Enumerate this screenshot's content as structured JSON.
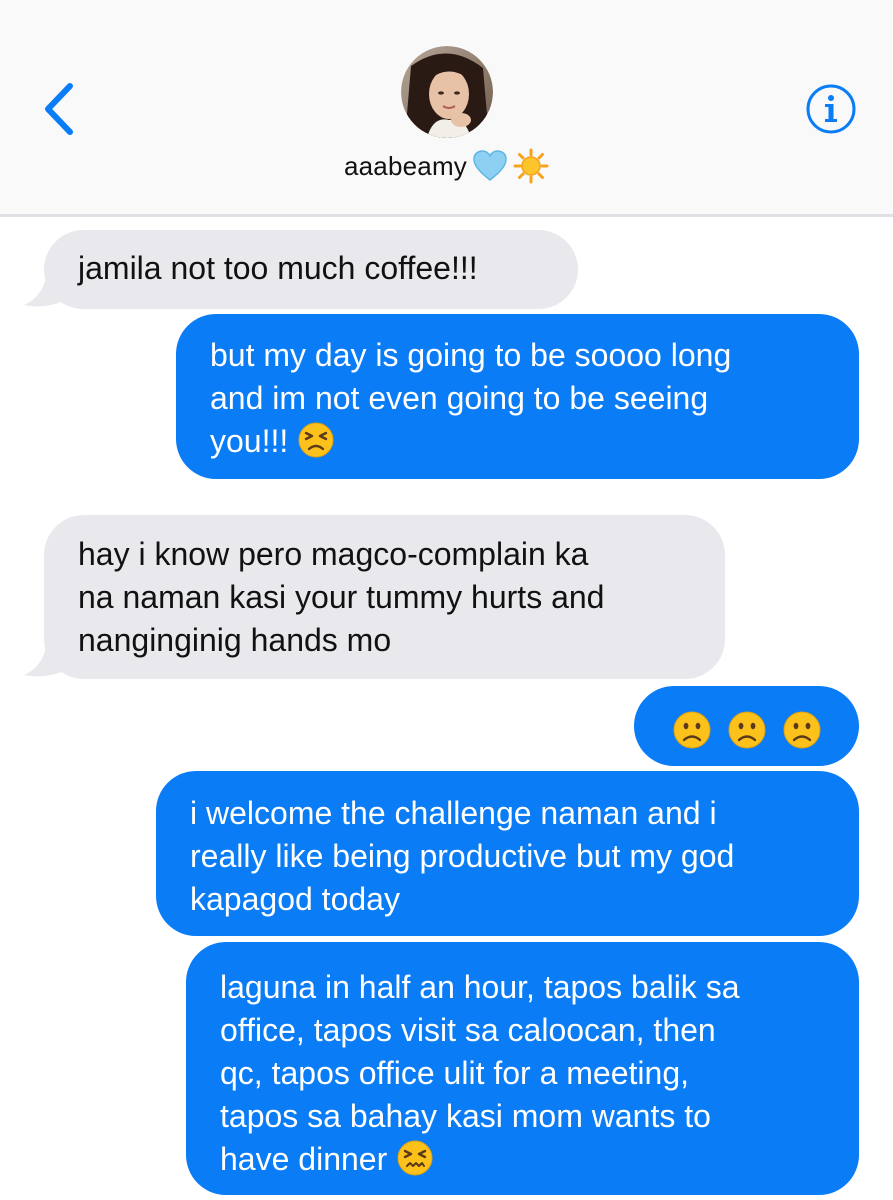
{
  "header": {
    "contact_name": "aaabeamy",
    "name_emojis": [
      "light-blue-heart-icon",
      "sun-icon"
    ],
    "colors": {
      "accent": "#0a7cf5",
      "header_bg": "#f9f9f9",
      "incoming_bubble": "#e8e8ed",
      "outgoing_bubble": "#0a7cf5"
    }
  },
  "messages": [
    {
      "direction": "incoming",
      "lines": [
        "jamila not too much coffee!!!"
      ]
    },
    {
      "direction": "outgoing",
      "lines": [
        "but my day is going to be soooo long",
        "and im not even going to be seeing",
        "you!!!"
      ],
      "trailing_emoji": "confounded-face-icon"
    },
    {
      "direction": "incoming",
      "lines": [
        "hay i know pero magco-complain ka",
        "na naman kasi your tummy hurts and",
        "nanginginig hands mo"
      ]
    },
    {
      "direction": "outgoing",
      "emojis": [
        "frowning-face-icon",
        "frowning-face-icon",
        "frowning-face-icon"
      ]
    },
    {
      "direction": "outgoing",
      "lines": [
        "i welcome the challenge naman and i",
        "really like being productive but my god",
        "kapagod today"
      ]
    },
    {
      "direction": "outgoing",
      "lines": [
        "laguna in half an hour, tapos balik sa",
        "office, tapos visit sa caloocan, then",
        "qc, tapos office ulit for a meeting,",
        "tapos sa bahay kasi mom wants to",
        "have dinner"
      ],
      "trailing_emoji": "confounded-face-icon"
    }
  ]
}
